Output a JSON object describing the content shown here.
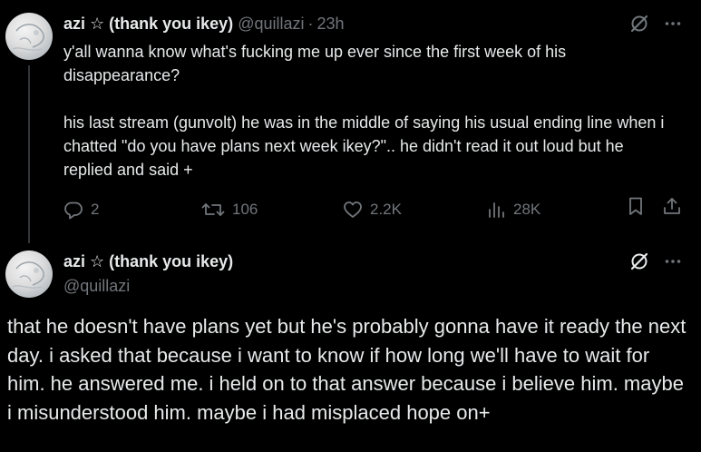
{
  "tweet1": {
    "display_name": "azi ☆ (thank you ikey)",
    "handle": "@quillazi",
    "separator": "·",
    "time": "23h",
    "text": "y'all wanna know what's fucking me up ever since the first week of his disappearance?\n\nhis last stream (gunvolt) he was in the middle of saying his usual ending line when i chatted \"do you have plans next week ikey?\".. he didn't read it out loud but he replied and said +",
    "replies": "2",
    "reposts": "106",
    "likes": "2.2K",
    "views": "28K"
  },
  "tweet2": {
    "display_name": "azi ☆ (thank you ikey)",
    "handle": "@quillazi",
    "text": "that he doesn't have plans yet but he's probably gonna have it ready the next day. i asked that because i want to know if how long we'll have to wait for him. he answered me. i held on to that answer because i believe him. maybe i misunderstood him. maybe i had misplaced hope on+"
  },
  "icons": {
    "grok": "grok-icon",
    "more": "more-icon",
    "reply": "reply-icon",
    "repost": "repost-icon",
    "like": "like-icon",
    "views": "views-icon",
    "bookmark": "bookmark-icon",
    "share": "share-icon"
  },
  "colors": {
    "background": "#000000",
    "text": "#e7e9ea",
    "secondary": "#71767b",
    "thread_line": "#333639"
  }
}
